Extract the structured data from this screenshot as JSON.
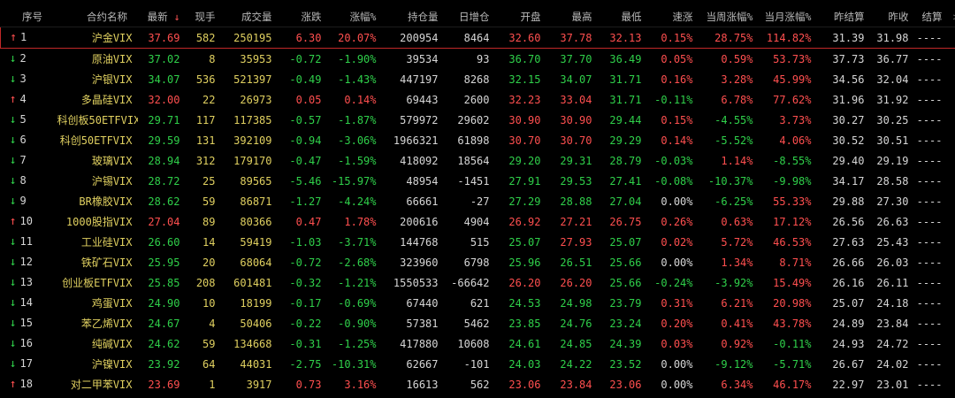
{
  "headers": {
    "idx": "序号",
    "name": "合约名称",
    "latest": "最新",
    "cur_vol": "现手",
    "volume": "成交量",
    "change": "涨跌",
    "change_pct": "涨幅%",
    "open_int": "持仓量",
    "daily_oi": "日增仓",
    "open": "开盘",
    "high": "最高",
    "low": "最低",
    "speed": "速涨",
    "week_pct": "当周涨幅%",
    "month_pct": "当月涨幅%",
    "prev_settle": "昨结算",
    "prev_close": "昨收",
    "settle": "结算",
    "more": ">>"
  },
  "colors": {
    "up": "#ff4f4f",
    "down": "#2fd04a",
    "flat": "#d6d6d6",
    "name": "#e0d060",
    "selected_border": "#c02828"
  },
  "rows": [
    {
      "dir": "up",
      "idx": "1",
      "name": "沪金VIX",
      "latest": "37.69",
      "cur_vol": "582",
      "volume": "250195",
      "change": "6.30",
      "change_pct": "20.07%",
      "open_int": "200954",
      "daily_oi": "8464",
      "open": "32.60",
      "high": "37.78",
      "low": "32.13",
      "speed": "0.15%",
      "week_pct": "28.75%",
      "month_pct": "114.82%",
      "prev_settle": "31.39",
      "prev_close": "31.98",
      "settle": "----"
    },
    {
      "dir": "down",
      "idx": "2",
      "name": "原油VIX",
      "latest": "37.02",
      "cur_vol": "8",
      "volume": "35953",
      "change": "-0.72",
      "change_pct": "-1.90%",
      "open_int": "39534",
      "daily_oi": "93",
      "open": "36.70",
      "high": "37.70",
      "low": "36.49",
      "speed": "0.05%",
      "week_pct": "0.59%",
      "month_pct": "53.73%",
      "prev_settle": "37.73",
      "prev_close": "36.77",
      "settle": "----"
    },
    {
      "dir": "down",
      "idx": "3",
      "name": "沪银VIX",
      "latest": "34.07",
      "cur_vol": "536",
      "volume": "521397",
      "change": "-0.49",
      "change_pct": "-1.43%",
      "open_int": "447197",
      "daily_oi": "8268",
      "open": "32.15",
      "high": "34.07",
      "low": "31.71",
      "speed": "0.16%",
      "week_pct": "3.28%",
      "month_pct": "45.99%",
      "prev_settle": "34.56",
      "prev_close": "32.04",
      "settle": "----"
    },
    {
      "dir": "up",
      "idx": "4",
      "name": "多晶硅VIX",
      "latest": "32.00",
      "cur_vol": "22",
      "volume": "26973",
      "change": "0.05",
      "change_pct": "0.14%",
      "open_int": "69443",
      "daily_oi": "2600",
      "open": "32.23",
      "high": "33.04",
      "low": "31.71",
      "speed": "-0.11%",
      "week_pct": "6.78%",
      "month_pct": "77.62%",
      "prev_settle": "31.96",
      "prev_close": "31.92",
      "settle": "----"
    },
    {
      "dir": "down",
      "idx": "5",
      "name": "科创板50ETFVIX",
      "latest": "29.71",
      "cur_vol": "117",
      "volume": "117385",
      "change": "-0.57",
      "change_pct": "-1.87%",
      "open_int": "579972",
      "daily_oi": "29602",
      "open": "30.90",
      "high": "30.90",
      "low": "29.44",
      "speed": "0.15%",
      "week_pct": "-4.55%",
      "month_pct": "3.73%",
      "prev_settle": "30.27",
      "prev_close": "30.25",
      "settle": "----"
    },
    {
      "dir": "down",
      "idx": "6",
      "name": "科创50ETFVIX",
      "latest": "29.59",
      "cur_vol": "131",
      "volume": "392109",
      "change": "-0.94",
      "change_pct": "-3.06%",
      "open_int": "1966321",
      "daily_oi": "61898",
      "open": "30.70",
      "high": "30.70",
      "low": "29.29",
      "speed": "0.14%",
      "week_pct": "-5.52%",
      "month_pct": "4.06%",
      "prev_settle": "30.52",
      "prev_close": "30.51",
      "settle": "----"
    },
    {
      "dir": "down",
      "idx": "7",
      "name": "玻璃VIX",
      "latest": "28.94",
      "cur_vol": "312",
      "volume": "179170",
      "change": "-0.47",
      "change_pct": "-1.59%",
      "open_int": "418092",
      "daily_oi": "18564",
      "open": "29.20",
      "high": "29.31",
      "low": "28.79",
      "speed": "-0.03%",
      "week_pct": "1.14%",
      "month_pct": "-8.55%",
      "prev_settle": "29.40",
      "prev_close": "29.19",
      "settle": "----"
    },
    {
      "dir": "down",
      "idx": "8",
      "name": "沪锡VIX",
      "latest": "28.72",
      "cur_vol": "25",
      "volume": "89565",
      "change": "-5.46",
      "change_pct": "-15.97%",
      "open_int": "48954",
      "daily_oi": "-1451",
      "open": "27.91",
      "high": "29.53",
      "low": "27.41",
      "speed": "-0.08%",
      "week_pct": "-10.37%",
      "month_pct": "-9.98%",
      "prev_settle": "34.17",
      "prev_close": "28.58",
      "settle": "----"
    },
    {
      "dir": "down",
      "idx": "9",
      "name": "BR橡胶VIX",
      "latest": "28.62",
      "cur_vol": "59",
      "volume": "86871",
      "change": "-1.27",
      "change_pct": "-4.24%",
      "open_int": "66661",
      "daily_oi": "-27",
      "open": "27.29",
      "high": "28.88",
      "low": "27.04",
      "speed": "0.00%",
      "week_pct": "-6.25%",
      "month_pct": "55.33%",
      "prev_settle": "29.88",
      "prev_close": "27.30",
      "settle": "----"
    },
    {
      "dir": "up",
      "idx": "10",
      "name": "1000股指VIX",
      "latest": "27.04",
      "cur_vol": "89",
      "volume": "80366",
      "change": "0.47",
      "change_pct": "1.78%",
      "open_int": "200616",
      "daily_oi": "4904",
      "open": "26.92",
      "high": "27.21",
      "low": "26.75",
      "speed": "0.26%",
      "week_pct": "0.63%",
      "month_pct": "17.12%",
      "prev_settle": "26.56",
      "prev_close": "26.63",
      "settle": "----"
    },
    {
      "dir": "down",
      "idx": "11",
      "name": "工业硅VIX",
      "latest": "26.60",
      "cur_vol": "14",
      "volume": "59419",
      "change": "-1.03",
      "change_pct": "-3.71%",
      "open_int": "144768",
      "daily_oi": "515",
      "open": "25.07",
      "high": "27.93",
      "low": "25.07",
      "speed": "0.02%",
      "week_pct": "5.72%",
      "month_pct": "46.53%",
      "prev_settle": "27.63",
      "prev_close": "25.43",
      "settle": "----"
    },
    {
      "dir": "down",
      "idx": "12",
      "name": "铁矿石VIX",
      "latest": "25.95",
      "cur_vol": "20",
      "volume": "68064",
      "change": "-0.72",
      "change_pct": "-2.68%",
      "open_int": "323960",
      "daily_oi": "6798",
      "open": "25.96",
      "high": "26.51",
      "low": "25.66",
      "speed": "0.00%",
      "week_pct": "1.34%",
      "month_pct": "8.71%",
      "prev_settle": "26.66",
      "prev_close": "26.03",
      "settle": "----"
    },
    {
      "dir": "down",
      "idx": "13",
      "name": "创业板ETFVIX",
      "latest": "25.85",
      "cur_vol": "208",
      "volume": "601481",
      "change": "-0.32",
      "change_pct": "-1.21%",
      "open_int": "1550533",
      "daily_oi": "-66642",
      "open": "26.20",
      "high": "26.20",
      "low": "25.66",
      "speed": "-0.24%",
      "week_pct": "-3.92%",
      "month_pct": "15.49%",
      "prev_settle": "26.16",
      "prev_close": "26.11",
      "settle": "----"
    },
    {
      "dir": "down",
      "idx": "14",
      "name": "鸡蛋VIX",
      "latest": "24.90",
      "cur_vol": "10",
      "volume": "18199",
      "change": "-0.17",
      "change_pct": "-0.69%",
      "open_int": "67440",
      "daily_oi": "621",
      "open": "24.53",
      "high": "24.98",
      "low": "23.79",
      "speed": "0.31%",
      "week_pct": "6.21%",
      "month_pct": "20.98%",
      "prev_settle": "25.07",
      "prev_close": "24.18",
      "settle": "----"
    },
    {
      "dir": "down",
      "idx": "15",
      "name": "苯乙烯VIX",
      "latest": "24.67",
      "cur_vol": "4",
      "volume": "50406",
      "change": "-0.22",
      "change_pct": "-0.90%",
      "open_int": "57381",
      "daily_oi": "5462",
      "open": "23.85",
      "high": "24.76",
      "low": "23.24",
      "speed": "0.20%",
      "week_pct": "0.41%",
      "month_pct": "43.78%",
      "prev_settle": "24.89",
      "prev_close": "23.84",
      "settle": "----"
    },
    {
      "dir": "down",
      "idx": "16",
      "name": "纯碱VIX",
      "latest": "24.62",
      "cur_vol": "59",
      "volume": "134668",
      "change": "-0.31",
      "change_pct": "-1.25%",
      "open_int": "417880",
      "daily_oi": "10608",
      "open": "24.61",
      "high": "24.85",
      "low": "24.39",
      "speed": "0.03%",
      "week_pct": "0.92%",
      "month_pct": "-0.11%",
      "prev_settle": "24.93",
      "prev_close": "24.72",
      "settle": "----"
    },
    {
      "dir": "down",
      "idx": "17",
      "name": "沪镍VIX",
      "latest": "23.92",
      "cur_vol": "64",
      "volume": "44031",
      "change": "-2.75",
      "change_pct": "-10.31%",
      "open_int": "62667",
      "daily_oi": "-101",
      "open": "24.03",
      "high": "24.22",
      "low": "23.52",
      "speed": "0.00%",
      "week_pct": "-9.12%",
      "month_pct": "-5.71%",
      "prev_settle": "26.67",
      "prev_close": "24.02",
      "settle": "----"
    },
    {
      "dir": "up",
      "idx": "18",
      "name": "对二甲苯VIX",
      "latest": "23.69",
      "cur_vol": "1",
      "volume": "3917",
      "change": "0.73",
      "change_pct": "3.16%",
      "open_int": "16613",
      "daily_oi": "562",
      "open": "23.06",
      "high": "23.84",
      "low": "23.06",
      "speed": "0.00%",
      "week_pct": "6.34%",
      "month_pct": "46.17%",
      "prev_settle": "22.97",
      "prev_close": "23.01",
      "settle": "----"
    }
  ]
}
